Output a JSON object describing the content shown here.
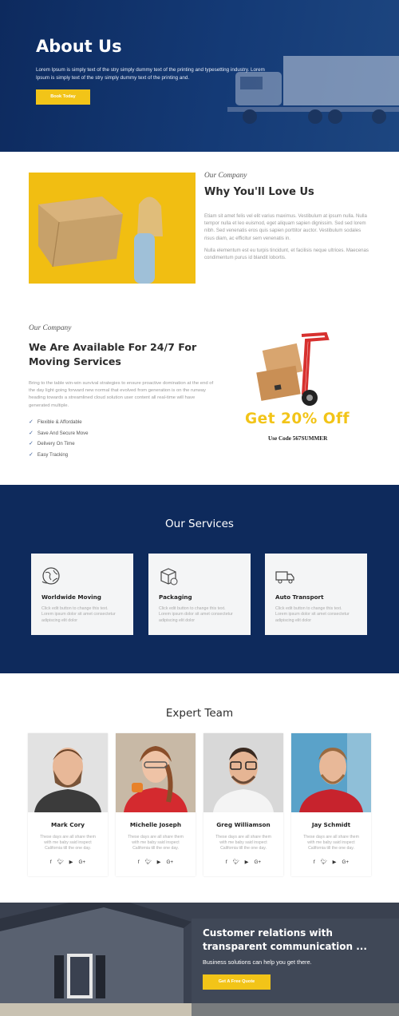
{
  "hero": {
    "title": "About Us",
    "text": "Lorem Ipsum is simply text of the stry simply dummy text of the printing and typesetting industry. Lorem Ipsum is simply text of the stry simply dummy text of the printing and.",
    "button": "Book Today"
  },
  "why": {
    "kicker": "Our Company",
    "title": "Why You'll Love Us",
    "para1": "Etiam sit amet felis vel elit varius maximus. Vestibulum at ipsum nulla. Nulla tempor nulla et leo euismod, eget aliquam sapien dignissim. Sed sed lorem nibh. Sed venenatis eros quis sapien porttitor auctor. Vestibulum sodales risus diam, ac efficitur sem venenatis in.",
    "para2": "Nulla elementum est eu turpis tincidunt, et facilisis neque ultrices. Maecenas condimentum purus id blandit lobortis."
  },
  "available": {
    "kicker": "Our Company",
    "title": "We Are Available For 24/7 For Moving Services",
    "para": "Bring to the table win-win survival strategies to ensure proactive domination at the end of the day light going forward new normal that evolved from generation is on the runway heading towards a streamlined cloud solution user content all real-time will have generated multiple.",
    "features": [
      "Flexible & Affordable",
      "Save And Secure Move",
      "Delivery On Time",
      "Easy Tracking"
    ],
    "discount": "Get 20% Off",
    "code": "Use Code 567SUMMER"
  },
  "services": {
    "title": "Our Services",
    "items": [
      {
        "title": "Worldwide Moving",
        "text": "Click edit button to change this text. Lorem ipsum dolor sit amet consectetur adipiscing elit dolor",
        "icon": "globe-icon"
      },
      {
        "title": "Packaging",
        "text": "Click edit button to change this text. Lorem ipsum dolor sit amet consectetur adipiscing elit dolor",
        "icon": "box-icon"
      },
      {
        "title": "Auto Transport",
        "text": "Click edit button to change this text. Lorem ipsum dolor sit amet consectetur adipiscing elit dolor",
        "icon": "truck-icon"
      }
    ]
  },
  "team": {
    "title": "Expert Team",
    "members": [
      {
        "name": "Mark Cory",
        "text": "These days are all share them with me baby said inspect California till the one day."
      },
      {
        "name": "Michelle Joseph",
        "text": "These days are all share them with me baby said inspect California till the one day."
      },
      {
        "name": "Greg Williamson",
        "text": "These days are all share them with me baby said inspect California till the one day."
      },
      {
        "name": "Jay Schmidt",
        "text": "These days are all share them with me baby said inspect California till the one day."
      }
    ],
    "social": [
      "f",
      "t",
      "yt",
      "G+"
    ]
  },
  "cta": {
    "title": "Customer relations with transparent communication ...",
    "subtitle": "Business solutions can help you get there.",
    "button": "Get A Free Quote"
  },
  "colors": {
    "navy": "#0e2a5c",
    "yellow": "#f2c418"
  }
}
